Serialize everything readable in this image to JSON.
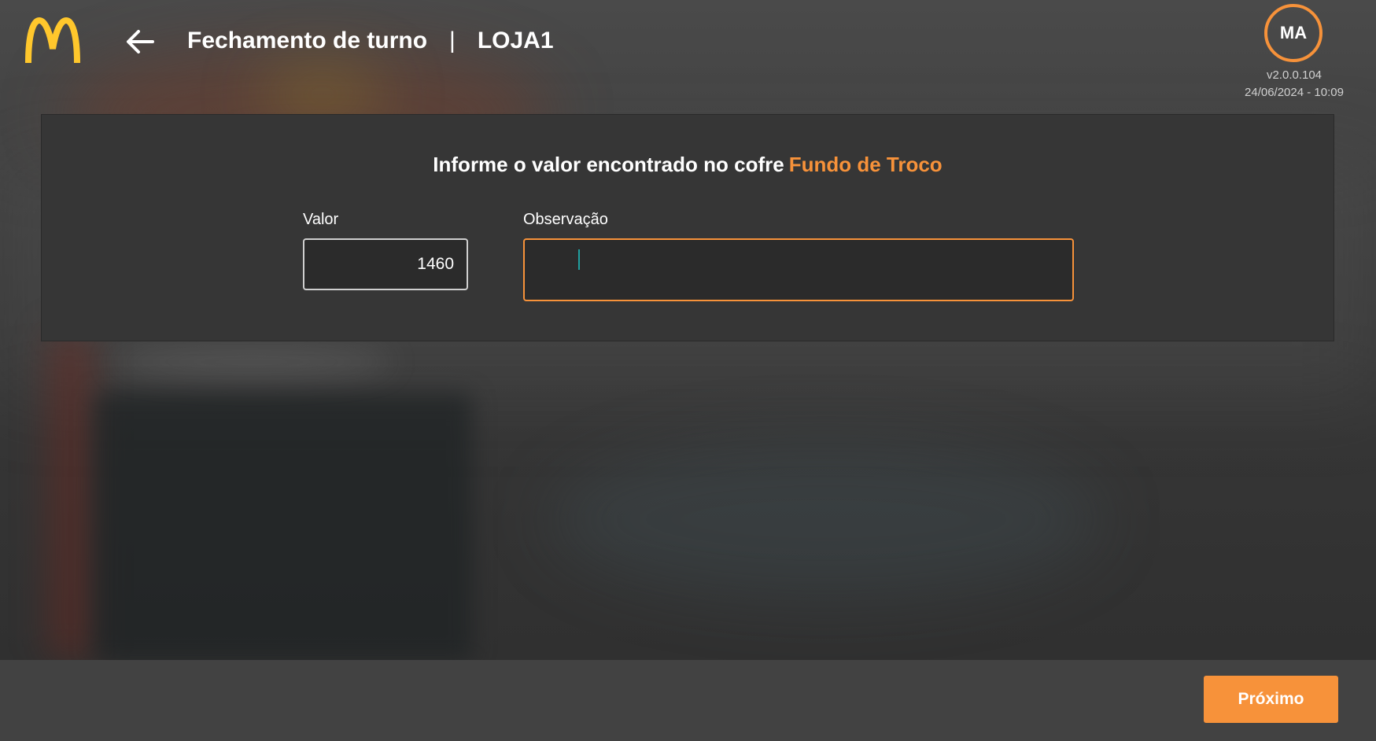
{
  "header": {
    "title": "Fechamento de turno",
    "separator": "|",
    "store": "LOJA1",
    "user_initials": "MA",
    "version": "v2.0.0.104",
    "datetime": "24/06/2024 - 10:09"
  },
  "form": {
    "prompt": "Informe o valor encontrado no cofre",
    "prompt_highlight": "Fundo de Troco",
    "valor_label": "Valor",
    "valor_value": "1460",
    "observacao_label": "Observação",
    "observacao_value": ""
  },
  "footer": {
    "next_label": "Próximo"
  },
  "colors": {
    "accent": "#f7923a",
    "logo": "#ffc72c",
    "background": "#3a3a3a",
    "card": "#363636",
    "footer": "#424242"
  },
  "icons": {
    "logo": "golden-arches-icon",
    "back": "arrow-left-icon"
  }
}
